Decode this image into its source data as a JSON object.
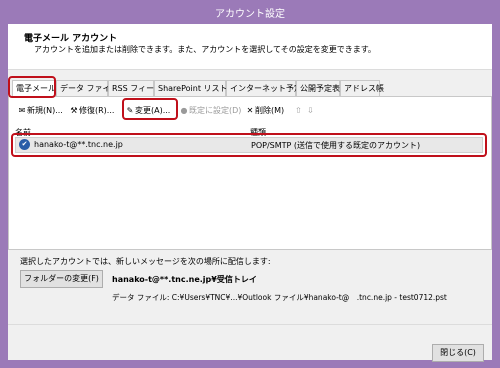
{
  "window": {
    "title": "アカウント設定"
  },
  "header": {
    "title": "電子メール アカウント",
    "description": "アカウントを追加または削除できます。また、アカウントを選択してその設定を変更できます。"
  },
  "tabs": [
    {
      "label": "電子メール",
      "active": true
    },
    {
      "label": "データ ファイル"
    },
    {
      "label": "RSS フィード"
    },
    {
      "label": "SharePoint リスト"
    },
    {
      "label": "インターネット予定表"
    },
    {
      "label": "公開予定表"
    },
    {
      "label": "アドレス帳"
    }
  ],
  "toolbar": {
    "new_label": "新規(N)...",
    "repair_label": "修復(R)...",
    "change_label": "変更(A)...",
    "default_label": "既定に設定(D)",
    "delete_label": "削除(M)",
    "up_arrow": "⇧",
    "down_arrow": "⇩"
  },
  "list": {
    "col_name": "名前",
    "col_type": "種類",
    "rows": [
      {
        "name": "hanako-t@**.tnc.ne.jp",
        "type": "POP/SMTP (送信で使用する既定のアカウント)",
        "check": "✔"
      }
    ]
  },
  "delivery": {
    "description": "選択したアカウントでは、新しいメッセージを次の場所に配信します:",
    "change_folder_label": "フォルダーの変更(F)",
    "folder": "hanako-t@**.tnc.ne.jp¥受信トレイ",
    "data_file": "データ ファイル: C:¥Users¥TNC¥...¥Outlook ファイル¥hanako-t@　.tnc.ne.jp - test0712.pst"
  },
  "footer": {
    "close_label": "閉じる(C)"
  },
  "colors": {
    "titlebar": "#9b7ab8",
    "highlight": "#c0101b"
  }
}
